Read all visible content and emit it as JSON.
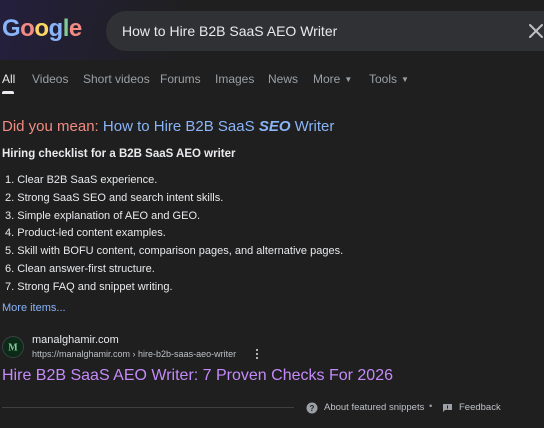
{
  "logo": {
    "g1": "G",
    "o1": "o",
    "o2": "o",
    "g2": "g",
    "l": "l",
    "e": "e"
  },
  "search": {
    "query": "How to Hire B2B SaaS AEO Writer"
  },
  "tabs": [
    {
      "label": "All",
      "active": true
    },
    {
      "label": "Videos"
    },
    {
      "label": "Short videos"
    },
    {
      "label": "Forums"
    },
    {
      "label": "Images"
    },
    {
      "label": "News"
    },
    {
      "label": "More"
    },
    {
      "label": "Tools"
    }
  ],
  "did_you_mean": {
    "label": "Did you mean:",
    "suggestion_pre": "How to Hire B2B SaaS",
    "suggestion_bold": "SEO",
    "suggestion_post": "Writer"
  },
  "featured_snippet": {
    "title": "Hiring checklist for a B2B SaaS AEO writer",
    "items": [
      "1. Clear B2B SaaS experience.",
      "2. Strong SaaS SEO and search intent skills.",
      "3. Simple explanation of AEO and GEO.",
      "4. Product-led content examples.",
      "5. Skill with BOFU content, comparison pages, and alternative pages.",
      "6. Clean answer-first structure.",
      "7. Strong FAQ and snippet writing."
    ],
    "more_items": "More items..."
  },
  "result": {
    "site_name": "manalghamir.com",
    "site_url": "https://manalghamir.com › hire-b2b-saas-aeo-writer",
    "favicon_letter": "M",
    "title": "Hire B2B SaaS AEO Writer: 7 Proven Checks For 2026"
  },
  "footer": {
    "about": "About featured snippets",
    "separator": "•",
    "feedback": "Feedback"
  },
  "colors": {
    "background": "#1f1f1f",
    "link": "#8ab4f8",
    "visited_link": "#c58af9",
    "did_you_mean_label": "#f28b82",
    "search_box": "#303134"
  },
  "icons": [
    "close-icon",
    "kebab-icon",
    "question-icon",
    "feedback-icon",
    "chevron-down-icon"
  ]
}
